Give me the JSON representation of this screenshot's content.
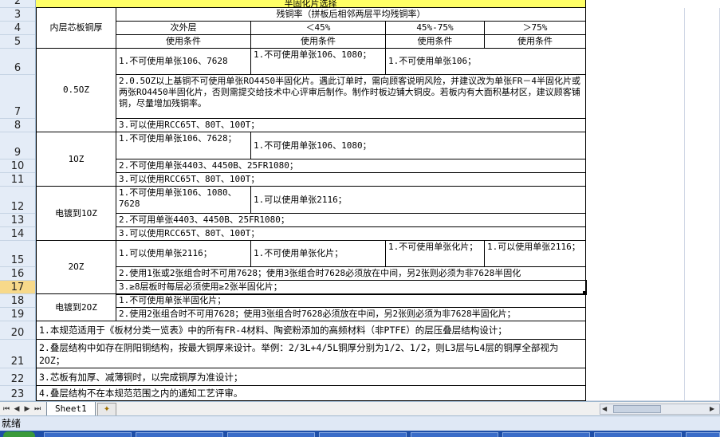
{
  "row_numbers": [
    "2",
    "3",
    "4",
    "5",
    "6",
    "7",
    "8",
    "9",
    "10",
    "11",
    "12",
    "13",
    "14",
    "15",
    "16",
    "17",
    "18",
    "19",
    "20",
    "21",
    "22",
    "23"
  ],
  "selected_row": "17",
  "table": {
    "top_title": "半固化片选择",
    "col_label": "内层芯板铜厚",
    "residual_header": "残铜率（拼板后相邻两层平均残铜率）",
    "band_headers": [
      "次外层",
      "＜45%",
      "45%-75%",
      "＞75%"
    ],
    "usage_label": "使用条件",
    "groups": {
      "g05": {
        "label": "0.5OZ",
        "r1": [
          "1.不可使用单张106、7628",
          "1.不可使用单张106、1080；",
          "1.不可使用单张106；"
        ],
        "r2": "2.0.5OZ以上基铜不可使用单张RO4450半固化片。遇此订单时，需向顾客说明风险，并建议改为单张FR－4半固化片或两张RO4450半固化片，否则需提交给技术中心评审后制作。制作时板边铺大铜皮。若板内有大面积基材区，建议顾客铺铜，尽量增加残铜率。",
        "r3": "3.可以使用RCC65T、80T、100T；"
      },
      "g1": {
        "label": "1OZ",
        "r1": [
          "1.不可使用单张106、7628；",
          "1.不可使用单张106、1080；"
        ],
        "r2": "2.不可使用单张4403、4450B、25FR1080；",
        "r3": "3.可以使用RCC65T、80T、100T；"
      },
      "gp": {
        "label": "电镀到1OZ",
        "r1": [
          "1.不可使用单张106、1080、7628",
          "1.可以使用单张2116；"
        ],
        "r2": "2.不可用单张4403、4450B、25FR1080；",
        "r3": "3.可以使用RCC65T、80T、100T；"
      },
      "g2": {
        "label": "2OZ",
        "r1": [
          "1.可以使用单张2116；",
          "1.不可使用单张化片；",
          "1.不可使用单张化片；",
          "1.可以使用单张2116；"
        ],
        "r2": "2.使用1张或2张组合时不可用7628；使用3张组合时7628必须放在中间，另2张则必须为非7628半固化",
        "r3": "3.≥8层板时每层必须使用≥2张半固化片；"
      },
      "g2p": {
        "label": "电镀到2OZ",
        "r1": "1.不可使用单张半固化片；",
        "r2": "2.使用2张组合时不可用7628；使用3张组合时7628必须放在中间，另2张则必须为非7628半固化片；"
      }
    },
    "notes": [
      "1.本规范适用于《板材分类一览表》中的所有FR-4材料、陶瓷粉添加的高频材料（非PTFE）的层压叠层结构设计；",
      "2.叠层结构中如存在阴阳铜结构，按最大铜厚来设计。举例：2/3L+4/5L铜厚分别为1/2、1/2，则L3层与L4层的铜厚全部视为2OZ；",
      "3.芯板有加厚、减薄铜时，以完成铜厚为准设计；",
      "4.叠层结构不在本规范范围之内的通知工艺评审。"
    ]
  },
  "sheet_tab": "Sheet1",
  "status_text": "就绪",
  "colors": {
    "title_fill": "#ffff66",
    "header_bg": "#e4ecf7",
    "selected_row_bg": "#f7d98a",
    "taskbar": "#1f4fa8"
  }
}
